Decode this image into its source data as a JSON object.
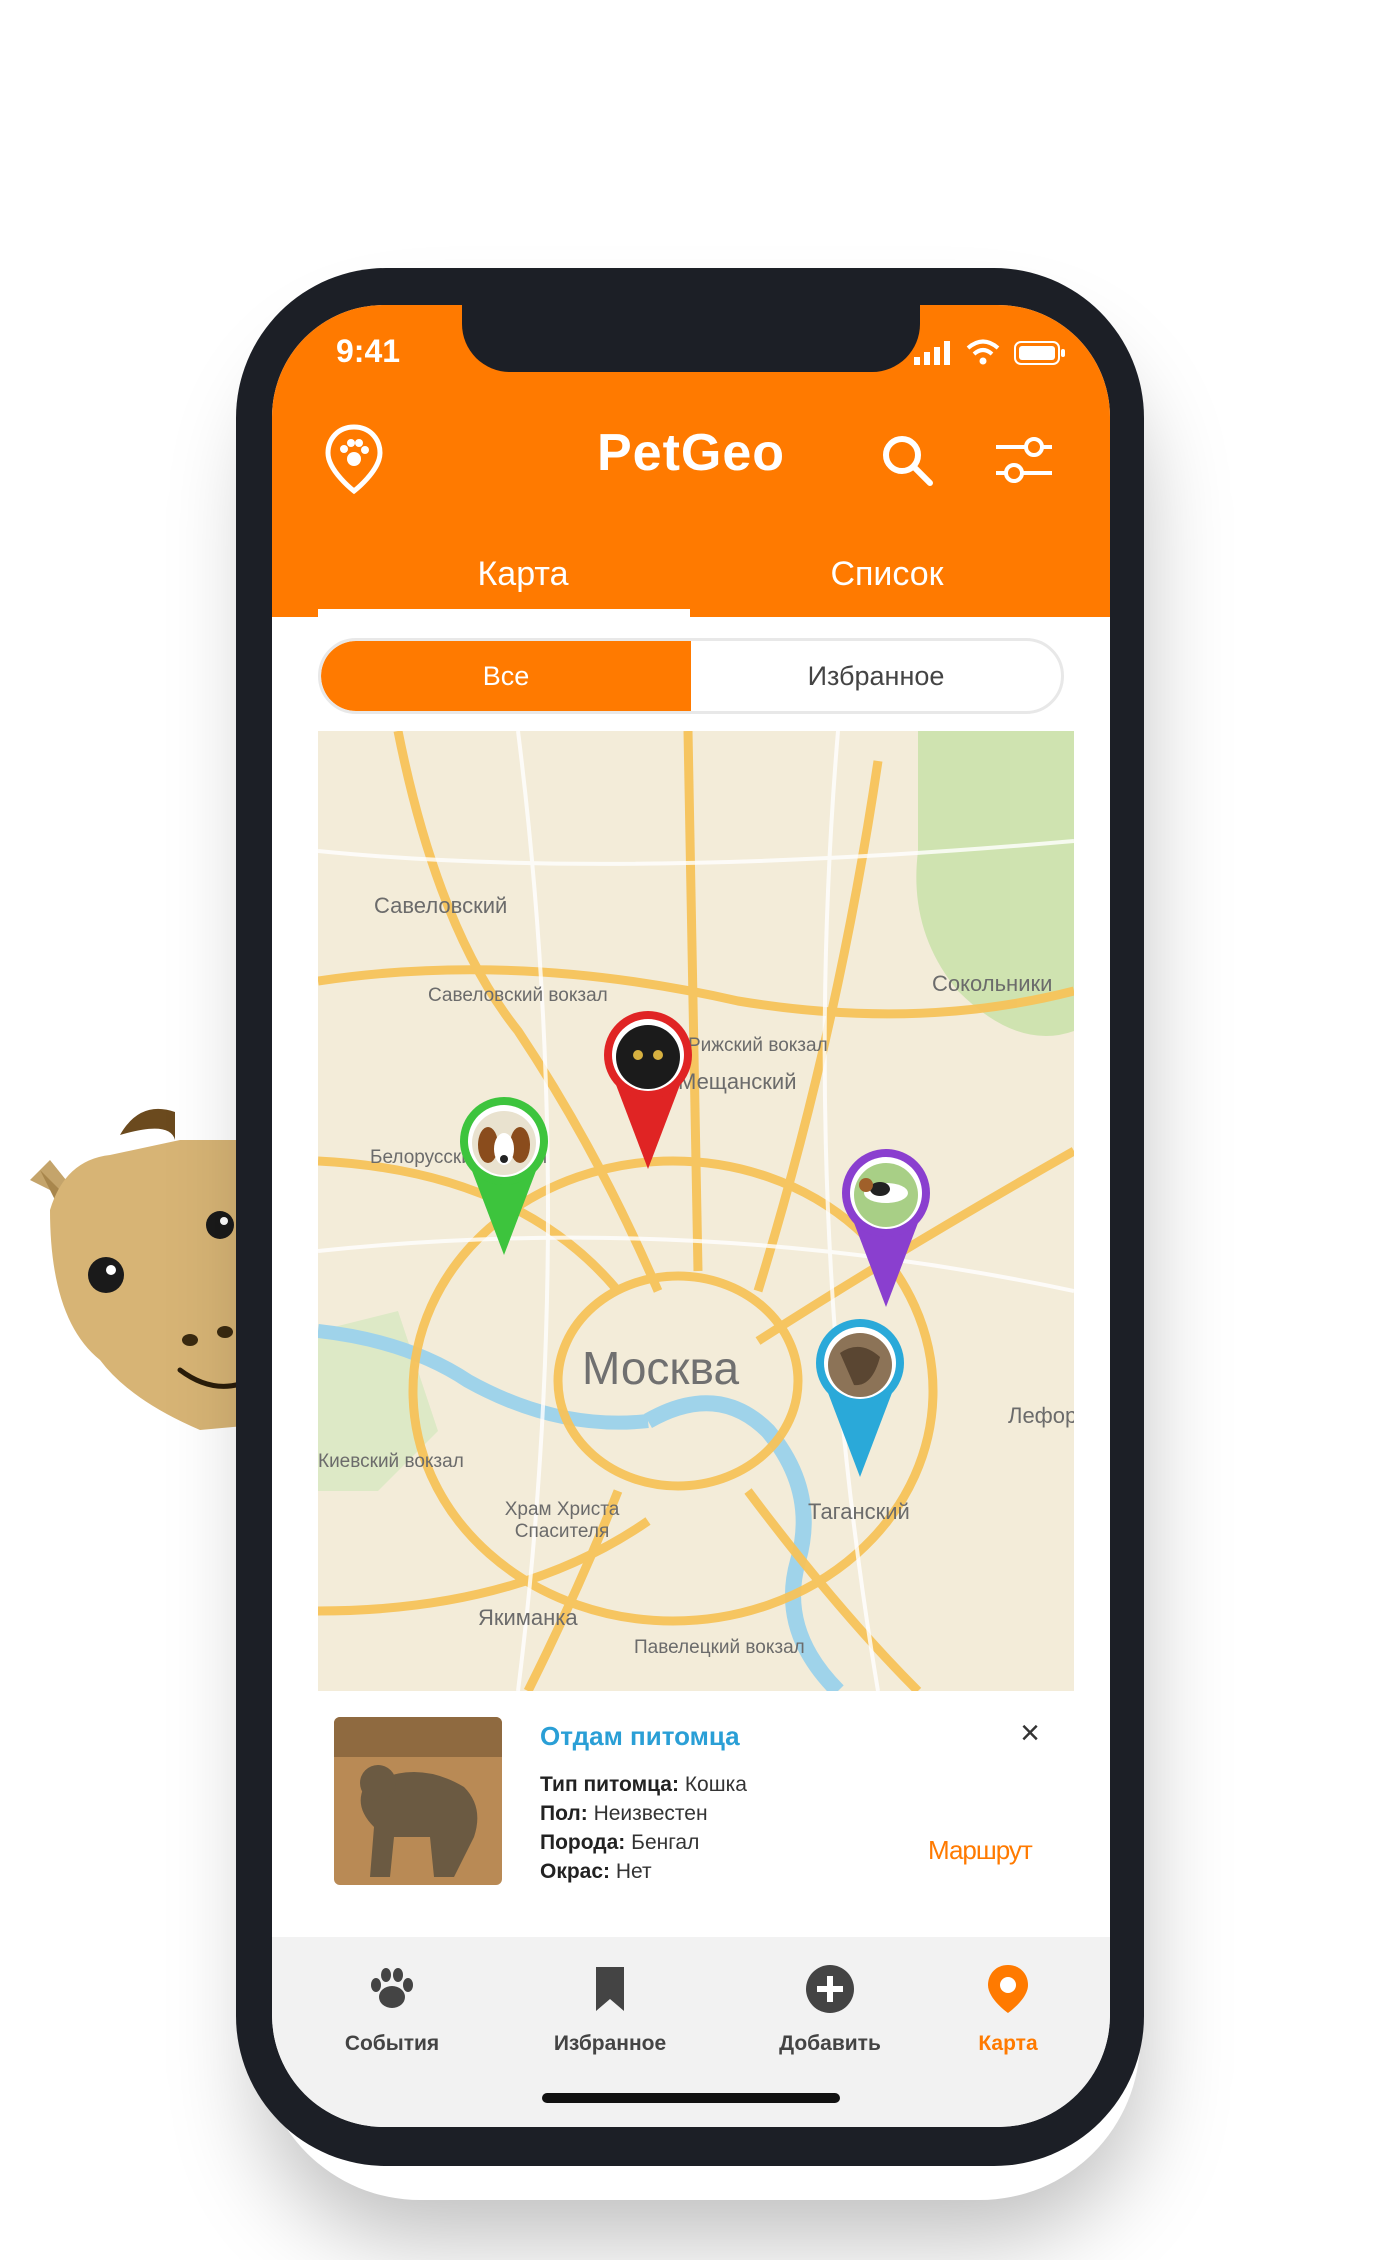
{
  "status_bar": {
    "time": "9:41"
  },
  "header": {
    "title": "PetGeo",
    "tabs": [
      {
        "label": "Карта",
        "active": true
      },
      {
        "label": "Список",
        "active": false
      }
    ]
  },
  "segment": {
    "options": [
      "Все",
      "Избранное"
    ],
    "selected": "Все"
  },
  "map": {
    "city_label": "Москва",
    "labels": [
      "Савеловский",
      "Савеловский вокзал",
      "Рижский вокзал",
      "Мещанский",
      "Белорусский вокзал",
      "Сокольники",
      "Лефортово",
      "Киевский вокзал",
      "Храм Христа Спасителя",
      "Таганский",
      "Якиманка",
      "Павелецкий вокзал"
    ],
    "pins": [
      {
        "pet": "cat",
        "color": "#e02424"
      },
      {
        "pet": "dog",
        "color": "#3dc43d"
      },
      {
        "pet": "dog",
        "color": "#8a3fcf"
      },
      {
        "pet": "cat",
        "color": "#2aa9d9"
      }
    ]
  },
  "card": {
    "title": "Отдам питомца",
    "rows": [
      {
        "label": "Тип питомца:",
        "value": "Кошка"
      },
      {
        "label": "Пол:",
        "value": "Неизвестен"
      },
      {
        "label": "Порода:",
        "value": "Бенгал"
      },
      {
        "label": "Окрас:",
        "value": "Нет"
      }
    ],
    "route_label": "Маршрут",
    "close_symbol": "×"
  },
  "nav": {
    "items": [
      {
        "label": "События",
        "icon": "paw-icon"
      },
      {
        "label": "Избранное",
        "icon": "bookmark-icon"
      },
      {
        "label": "Добавить",
        "icon": "plus-circle-icon"
      },
      {
        "label": "Карта",
        "icon": "map-pin-icon",
        "active": true
      }
    ]
  },
  "colors": {
    "brand": "#ff7a00",
    "title_blue": "#2a9fd6"
  }
}
